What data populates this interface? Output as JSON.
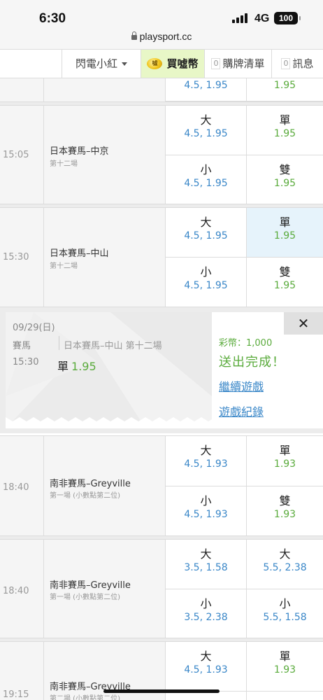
{
  "status": {
    "time": "6:30",
    "network": "4G",
    "battery": "100"
  },
  "url": "playsport.cc",
  "nav": {
    "user": "閃電小紅",
    "buy": "買噓幣",
    "buy_coin": "噓",
    "cart_count": "0",
    "cart": "購牌清單",
    "msg_count": "0",
    "msg": "訊息"
  },
  "top_partial": {
    "left_odds": "4.5, 1.95",
    "right_odds": "1.95"
  },
  "races": [
    {
      "time": "15:05",
      "name": "日本賽馬–中京",
      "sub": "第十二場",
      "cells": [
        {
          "label": "大",
          "odds": "4.5, 1.95"
        },
        {
          "label": "單",
          "odds": "1.95"
        },
        {
          "label": "小",
          "odds": "4.5, 1.95"
        },
        {
          "label": "雙",
          "odds": "1.95"
        }
      ]
    },
    {
      "time": "15:30",
      "name": "日本賽馬–中山",
      "sub": "第十二場",
      "cells": [
        {
          "label": "大",
          "odds": "4.5, 1.95"
        },
        {
          "label": "單",
          "odds": "1.95"
        },
        {
          "label": "小",
          "odds": "4.5, 1.95"
        },
        {
          "label": "雙",
          "odds": "1.95"
        }
      ]
    },
    {
      "time": "18:40",
      "name": "南非賽馬–Greyville",
      "sub": "第一場 (小數點第二位)",
      "cells": [
        {
          "label": "大",
          "odds": "4.5, 1.93"
        },
        {
          "label": "單",
          "odds": "1.93"
        },
        {
          "label": "小",
          "odds": "4.5, 1.93"
        },
        {
          "label": "雙",
          "odds": "1.93"
        }
      ]
    },
    {
      "time": "18:40",
      "name": "南非賽馬–Greyville",
      "sub": "第一場 (小數點第二位)",
      "cells": [
        {
          "label": "大",
          "odds": "3.5, 1.58"
        },
        {
          "label": "大",
          "odds": "5.5, 2.38"
        },
        {
          "label": "小",
          "odds": "3.5, 2.38"
        },
        {
          "label": "小",
          "odds": "5.5, 1.58"
        }
      ]
    },
    {
      "time": "19:15",
      "name": "南非賽馬–Greyville",
      "sub": "第二場 (小數點第二位)",
      "cells": [
        {
          "label": "大",
          "odds": "4.5, 1.93"
        },
        {
          "label": "單",
          "odds": "1.93"
        }
      ]
    }
  ],
  "popup": {
    "date": "09/29(日)",
    "kind": "賽馬",
    "race": "日本賽馬–中山 第十二場",
    "time": "15:30",
    "pick_label": "單",
    "pick_odds": "1.95",
    "coins": "彩幣：1,000",
    "done": "送出完成！",
    "continue": "繼續遊戲",
    "history": "遊戲紀錄",
    "close": "✕"
  },
  "colors": {
    "odds_blue": "#3a87c8",
    "odds_green": "#5aab3c",
    "buy_bg": "#e8f7c7",
    "selected_bg": "#e6f3fb"
  },
  "icons": [
    "lock-icon",
    "signal-icon",
    "battery-icon",
    "coin-icon",
    "caret-down-icon",
    "close-icon"
  ]
}
